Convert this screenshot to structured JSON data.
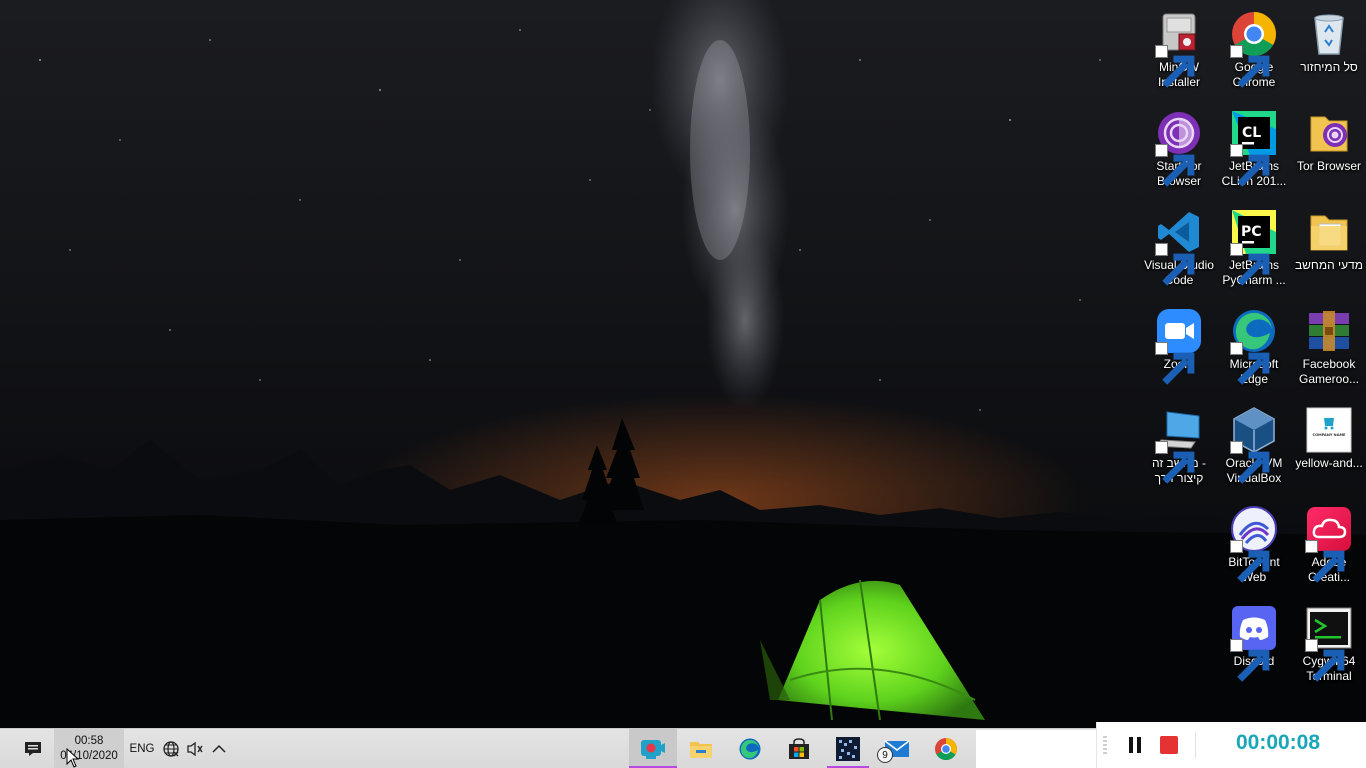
{
  "desktop": {
    "icons": [
      {
        "label": "MinGW\nInstaller"
      },
      {
        "label": "Google\nChrome"
      },
      {
        "label": "סל המיחזור"
      },
      {
        "label": "Start Tor\nBrowser"
      },
      {
        "label": "JetBrains\nCLion 201..."
      },
      {
        "label": "Tor Browser"
      },
      {
        "label": "Visual Studio\nCode"
      },
      {
        "label": "JetBrains\nPyCharm ..."
      },
      {
        "label": "מדעי המחשב"
      },
      {
        "label": "Zoom"
      },
      {
        "label": "Microsoft\nEdge"
      },
      {
        "label": "Facebook\nGameroo..."
      },
      {
        "label": "מחשב זה -\nקיצור דרך"
      },
      {
        "label": "Oracle VM\nVirtualBox"
      },
      {
        "label": "yellow-and..."
      },
      {
        "label": "BitTorrent\nWeb"
      },
      {
        "label": "Adobe\nCreati..."
      },
      {
        "label": "Discord"
      },
      {
        "label": "Cygwin64\nTerminal"
      }
    ],
    "thumbnail_text": "COMPANY NAME"
  },
  "taskbar": {
    "clock": {
      "time": "00:58",
      "date": "04/10/2020"
    },
    "language": "ENG",
    "mail_badge": "9",
    "tray_icons": [
      "action-center-icon",
      "network-icon",
      "volume-muted-icon",
      "show-hidden-icons-chevron"
    ],
    "pinned_apps": [
      "camera-recorder-icon",
      "file-explorer-icon",
      "edge-icon",
      "store-icon",
      "dark-app-icon",
      "mail-icon",
      "chrome-icon"
    ]
  },
  "recorder": {
    "timer": "00:00:08",
    "controls": [
      "pause-icon",
      "stop-icon"
    ],
    "accent_color": "#19a7b8",
    "stop_color": "#e53333"
  }
}
